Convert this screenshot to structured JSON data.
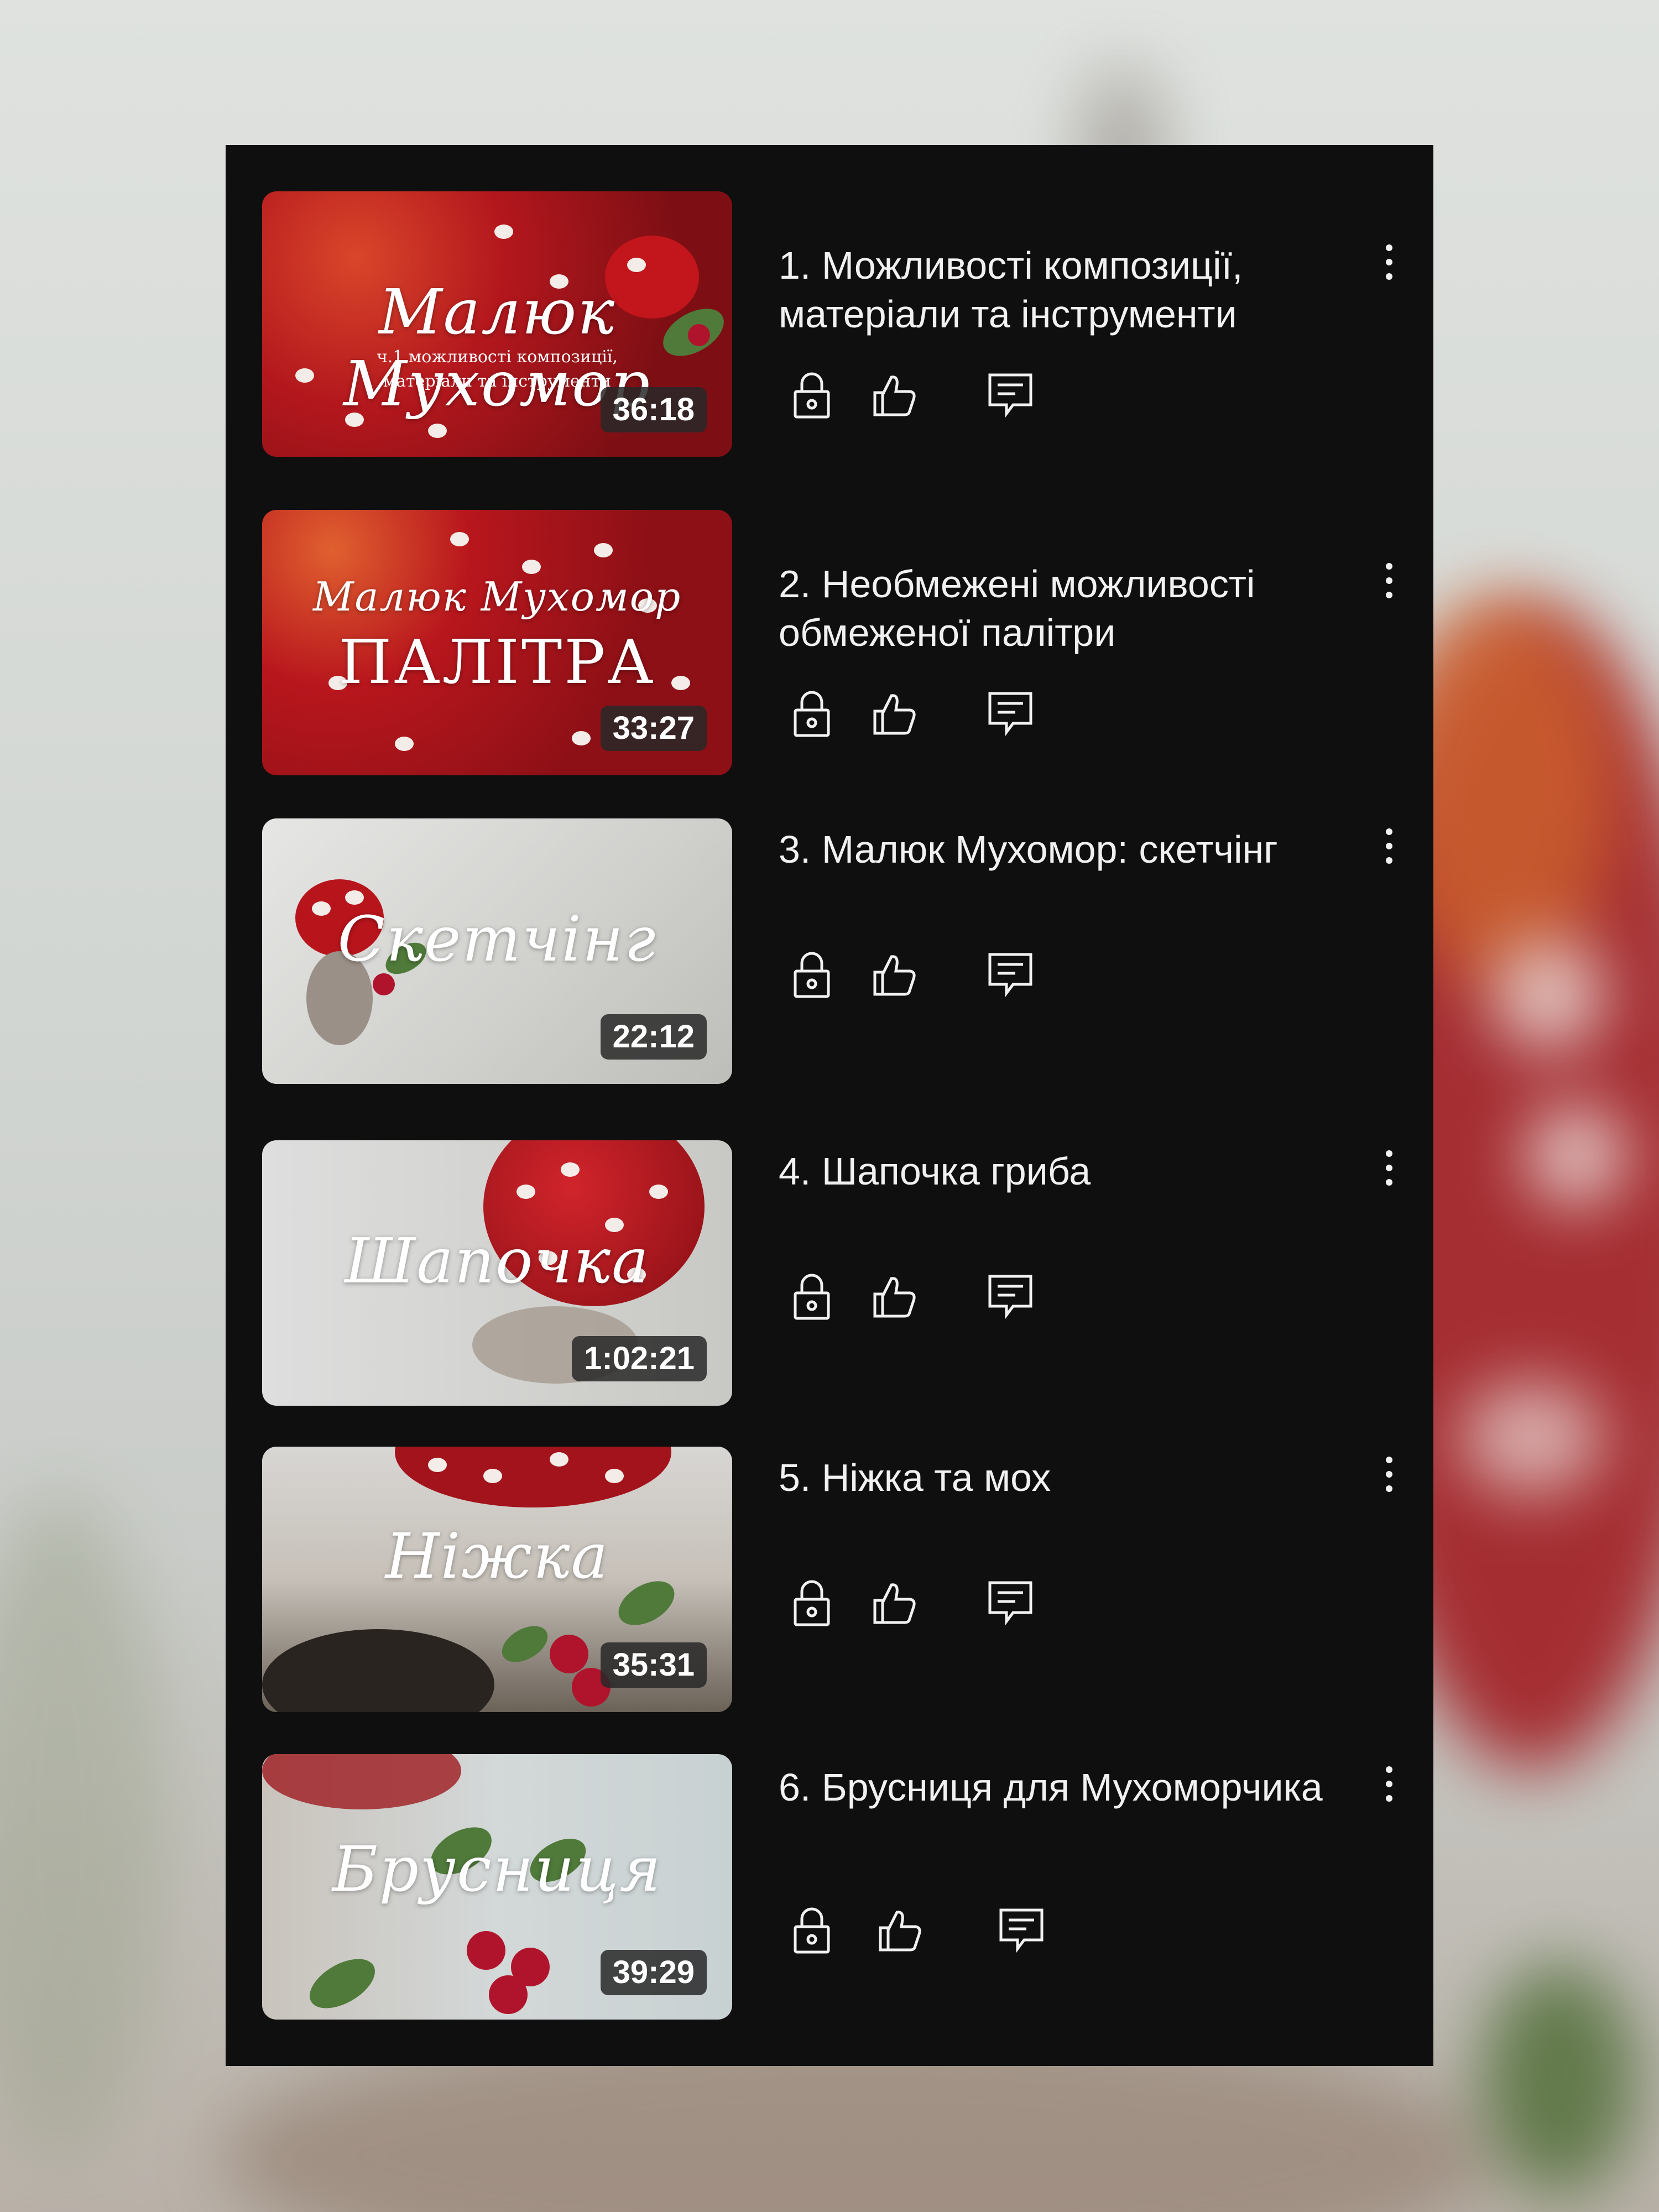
{
  "colors": {
    "panel_background": "#0f0f0f",
    "title_text": "#f1f1f1",
    "duration_badge": "#282828",
    "icon_stroke": "#f1f1f1"
  },
  "actions": {
    "icons": [
      "lock-icon",
      "thumbs-up-icon",
      "comment-icon"
    ]
  },
  "playlist": {
    "items": [
      {
        "title": "1. Можливості композиції, матеріали та інструменти",
        "duration": "36:18",
        "thumb_text": "Малюк Мухомор",
        "thumb_subtext": "ч.1 можливості композиції, матеріали та інструменти"
      },
      {
        "title": "2. Необмежені можливості обмеженої палітри",
        "duration": "33:27",
        "thumb_text": "Малюк Мухомор",
        "thumb_subtext": "ПАЛІТРА"
      },
      {
        "title": "3. Малюк Мухомор: скетчінг",
        "duration": "22:12",
        "thumb_text": "Скетчінг",
        "thumb_subtext": ""
      },
      {
        "title": "4. Шапочка гриба",
        "duration": "1:02:21",
        "thumb_text": "Шапочка",
        "thumb_subtext": ""
      },
      {
        "title": "5. Ніжка та мох",
        "duration": "35:31",
        "thumb_text": "Ніжка",
        "thumb_subtext": ""
      },
      {
        "title": "6. Брусниця для Мухоморчика",
        "duration": "39:29",
        "thumb_text": "Брусниця",
        "thumb_subtext": ""
      }
    ]
  }
}
